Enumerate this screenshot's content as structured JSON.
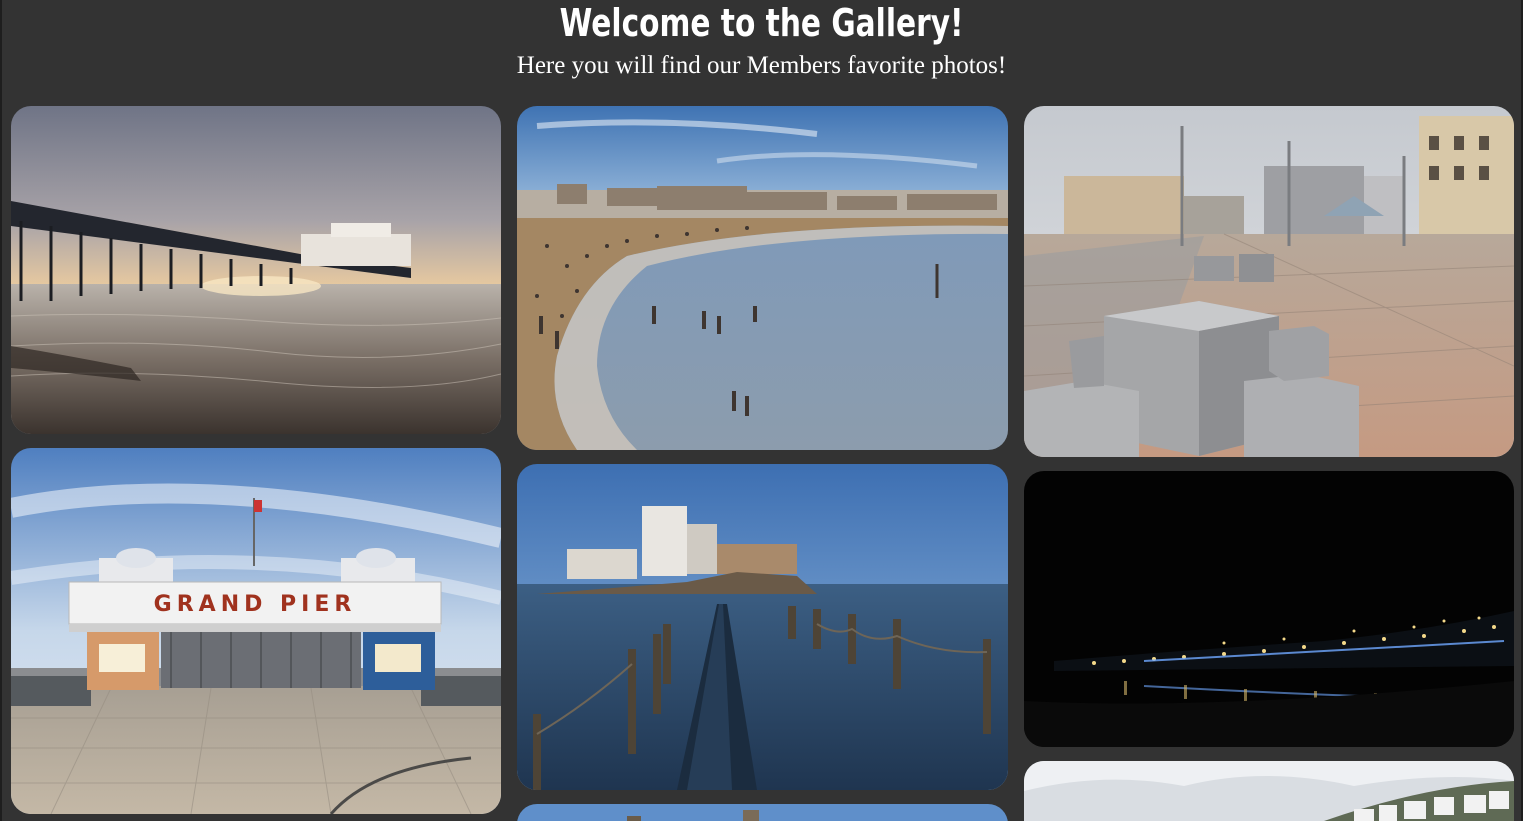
{
  "header": {
    "title": "Welcome to the Gallery!",
    "subtitle": "Here you will find our Members favorite photos!"
  },
  "gallery": {
    "photos": [
      {
        "name": "pier-at-sunset-photo"
      },
      {
        "name": "crowded-beach-photo"
      },
      {
        "name": "promenade-stone-cubes-photo"
      },
      {
        "name": "grand-pier-entrance-photo"
      },
      {
        "name": "causeway-to-island-photo"
      },
      {
        "name": "seafront-at-night-photo"
      },
      {
        "name": "hillside-town-photo"
      },
      {
        "name": "partial-bottom-photo"
      }
    ],
    "grand_pier_sign": "GRAND PIER"
  },
  "colors": {
    "background": "#333333",
    "text": "#ffffff"
  }
}
